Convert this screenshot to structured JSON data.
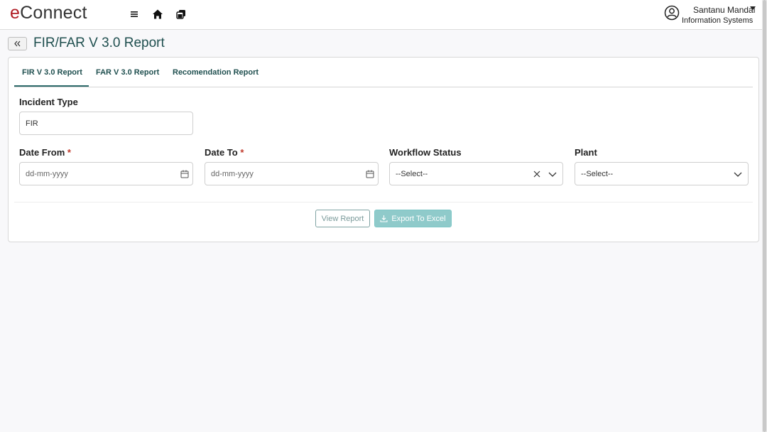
{
  "header": {
    "logo_e": "e",
    "logo_rest": "Connect",
    "nav_icons": [
      "menu-icon",
      "home-icon",
      "cards-icon"
    ],
    "user_name": "Santanu Mandal",
    "user_department": "Information Systems"
  },
  "page": {
    "title": "FIR/FAR V 3.0 Report",
    "back_icon": "double-chevron-left-icon"
  },
  "tabs": [
    {
      "label": "FIR V 3.0 Report",
      "active": true
    },
    {
      "label": "FAR V 3.0 Report",
      "active": false
    },
    {
      "label": "Recomendation Report",
      "active": false
    }
  ],
  "form": {
    "incident_type": {
      "label": "Incident Type",
      "value": "FIR"
    },
    "date_from": {
      "label": "Date From",
      "required_mark": "*",
      "placeholder": "dd-mm-yyyy"
    },
    "date_to": {
      "label": "Date To",
      "required_mark": "*",
      "placeholder": "dd-mm-yyyy"
    },
    "workflow_status": {
      "label": "Workflow Status",
      "value": "--Select--"
    },
    "plant": {
      "label": "Plant",
      "value": "--Select--"
    }
  },
  "actions": {
    "view_report": "View Report",
    "export_excel": "Export To Excel"
  },
  "colors": {
    "brand_red": "#b01c24",
    "accent_teal": "#2d6a6a",
    "export_button": "#8fcaca"
  }
}
